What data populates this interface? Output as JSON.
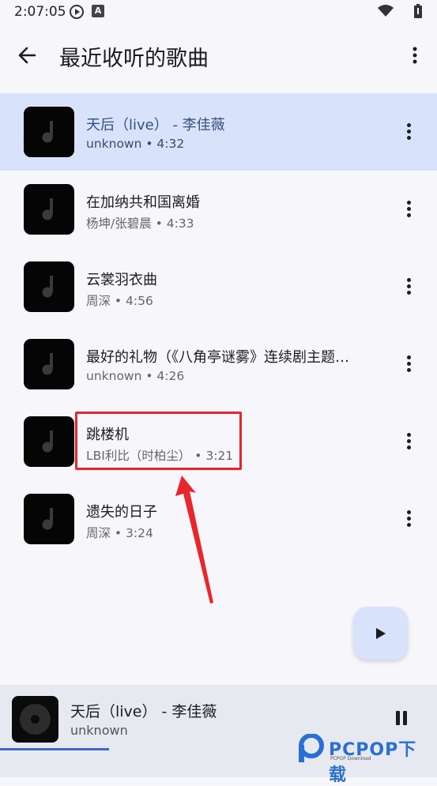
{
  "status": {
    "time": "2:07:05"
  },
  "appbar": {
    "title": "最近收听的歌曲"
  },
  "songs": [
    {
      "title": "天后（live） - 李佳薇",
      "subtitle": "unknown • 4:32",
      "active": true
    },
    {
      "title": "在加纳共和国离婚",
      "subtitle": "杨坤/张碧晨 • 4:33"
    },
    {
      "title": "云裳羽衣曲",
      "subtitle": "周深 • 4:56"
    },
    {
      "title": "最好的礼物（《八角亭谜雾》连续剧主题…",
      "subtitle": "unknown • 4:26"
    },
    {
      "title": "跳楼机",
      "subtitle": "LBI利比（时柏尘） • 3:21"
    },
    {
      "title": "遗失的日子",
      "subtitle": "周深 • 3:24"
    }
  ],
  "now_playing": {
    "title": "天后（live） - 李佳薇",
    "artist": "unknown",
    "progress": 0.25
  },
  "watermark": {
    "brand": "PCPOP下载",
    "sub": "PCPOP Download"
  },
  "colors": {
    "active_row": "#d9e2fb",
    "annotation": "#e8262b",
    "progress": "#3d68c9"
  }
}
